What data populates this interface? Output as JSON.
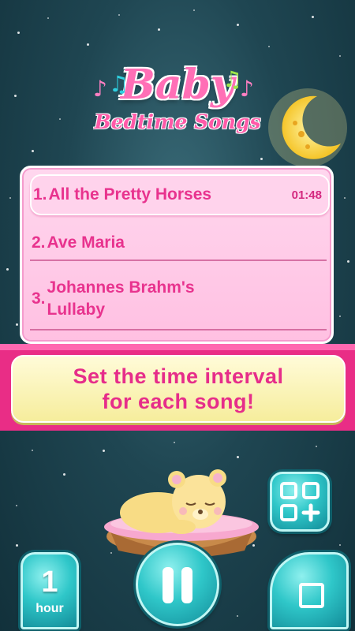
{
  "app": {
    "title_main": "Baby",
    "title_sub": "Bedtime Songs"
  },
  "playlist": {
    "songs": [
      {
        "number": "1.",
        "name": "All the Pretty Horses",
        "duration": "01:48",
        "active": true
      },
      {
        "number": "2.",
        "name": "Ave Maria",
        "duration": "",
        "active": false
      },
      {
        "number": "3.",
        "name": "Johannes Brahm's Lullaby",
        "duration": "",
        "active": false
      }
    ]
  },
  "banner": {
    "line1": "Set the time interval",
    "line2": "for each song!"
  },
  "controls": {
    "timer_value": "1",
    "timer_unit": "hour",
    "icons": {
      "add_playlist": "grid-plus-icon",
      "play_pause": "pause-icon",
      "stop": "stop-icon"
    }
  },
  "colors": {
    "accent_pink": "#e92d86",
    "button_teal": "#2fc7c9",
    "banner_yellow": "#fffbd8",
    "background": "#1f4652"
  }
}
